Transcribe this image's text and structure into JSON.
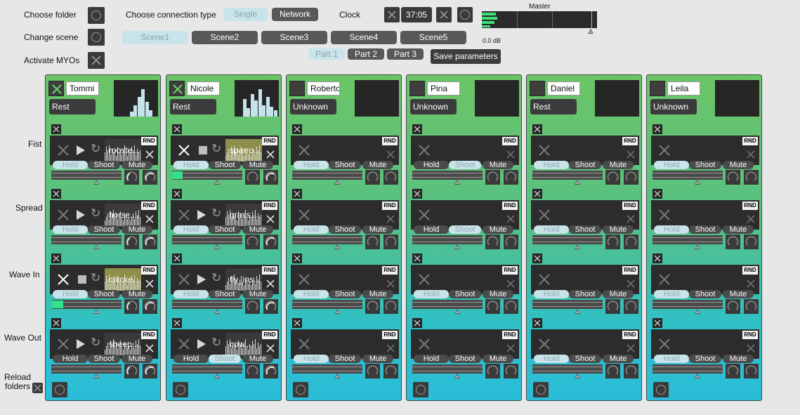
{
  "controls": {
    "choose_folder": "Choose folder",
    "change_scene": "Change scene",
    "activate_myos": "Activate MYOs",
    "choose_connection_type": "Choose connection type",
    "conn_single": "Single",
    "conn_network": "Network",
    "clock": "Clock",
    "clock_value": "37:05",
    "master": "Master",
    "master_db": "0.0 dB",
    "save_parameters": "Save parameters",
    "reload_folders": "Reload\nfolders"
  },
  "scenes": [
    "Scene1",
    "Scene2",
    "Scene3",
    "Scene4",
    "Scene5"
  ],
  "active_scene": 0,
  "parts": [
    "Part 1",
    "Part 2",
    "Part 3"
  ],
  "active_part": 0,
  "gestures": [
    "Fist",
    "Spread",
    "Wave In",
    "Wave Out"
  ],
  "button_labels": {
    "hold": "Hold",
    "shoot": "Shoot",
    "mute": "Mute",
    "rnd": "RND"
  },
  "players": [
    {
      "name": "Tommi",
      "state": "Rest",
      "enabled": true,
      "histogram": [
        0,
        0,
        0,
        0.15,
        0.35,
        0.6,
        0.85,
        0.45,
        0.2,
        0
      ],
      "slots": [
        {
          "file": "rooste...",
          "playing": false,
          "mode": [
            "off",
            "on",
            "on"
          ],
          "level": 0
        },
        {
          "file": "horse....",
          "playing": false,
          "mode": [
            "off",
            "on",
            "on"
          ],
          "level": 0
        },
        {
          "file": "chicke...",
          "playing": true,
          "mode": [
            "off",
            "on",
            "on"
          ],
          "level": 0.17
        },
        {
          "file": "sheep....",
          "playing": false,
          "mode": [
            "on",
            "on",
            "on"
          ],
          "level": 0
        }
      ]
    },
    {
      "name": "Nicole",
      "state": "Rest",
      "enabled": true,
      "histogram": [
        0,
        0.55,
        0.25,
        0.7,
        0.5,
        0.85,
        0.35,
        0.6,
        0.3,
        0.2
      ],
      "slots": [
        {
          "file": "sparro...",
          "playing": true,
          "mode": [
            "off",
            "on",
            "on"
          ],
          "level": 0.15
        },
        {
          "file": "grass....",
          "playing": false,
          "mode": [
            "off",
            "on",
            "on"
          ],
          "level": 0
        },
        {
          "file": "fly_ins...",
          "playing": false,
          "mode": [
            "off",
            "on",
            "on"
          ],
          "level": 0
        },
        {
          "file": "cow....",
          "playing": false,
          "mode": [
            "on",
            "off",
            "on"
          ],
          "level": 0
        }
      ]
    },
    {
      "name": "Roberto",
      "state": "Unknown",
      "enabled": false,
      "histogram": [],
      "slots": [
        {
          "file": "",
          "playing": false,
          "mode": [
            "off",
            "on",
            "on"
          ],
          "level": 0
        },
        {
          "file": "",
          "playing": false,
          "mode": [
            "off",
            "on",
            "on"
          ],
          "level": 0
        },
        {
          "file": "",
          "playing": false,
          "mode": [
            "off",
            "on",
            "on"
          ],
          "level": 0
        },
        {
          "file": "",
          "playing": false,
          "mode": [
            "off",
            "on",
            "on"
          ],
          "level": 0
        }
      ]
    },
    {
      "name": "Pina",
      "state": "Unknown",
      "enabled": false,
      "histogram": [],
      "slots": [
        {
          "file": "",
          "playing": false,
          "mode": [
            "on",
            "off",
            "on"
          ],
          "level": 0
        },
        {
          "file": "",
          "playing": false,
          "mode": [
            "on",
            "off",
            "on"
          ],
          "level": 0
        },
        {
          "file": "",
          "playing": false,
          "mode": [
            "off",
            "on",
            "on"
          ],
          "level": 0
        },
        {
          "file": "",
          "playing": false,
          "mode": [
            "on",
            "on",
            "on"
          ],
          "level": 0
        }
      ]
    },
    {
      "name": "Daniel",
      "state": "Rest",
      "enabled": false,
      "histogram": [],
      "slots": [
        {
          "file": "",
          "playing": false,
          "mode": [
            "off",
            "on",
            "on"
          ],
          "level": 0
        },
        {
          "file": "",
          "playing": false,
          "mode": [
            "off",
            "on",
            "on"
          ],
          "level": 0
        },
        {
          "file": "",
          "playing": false,
          "mode": [
            "off",
            "on",
            "on"
          ],
          "level": 0
        },
        {
          "file": "",
          "playing": false,
          "mode": [
            "off",
            "on",
            "on"
          ],
          "level": 0
        }
      ]
    },
    {
      "name": "Leila",
      "state": "Unknown",
      "enabled": false,
      "histogram": [],
      "slots": [
        {
          "file": "",
          "playing": false,
          "mode": [
            "off",
            "on",
            "on"
          ],
          "level": 0
        },
        {
          "file": "",
          "playing": false,
          "mode": [
            "off",
            "on",
            "on"
          ],
          "level": 0
        },
        {
          "file": "",
          "playing": false,
          "mode": [
            "off",
            "on",
            "on"
          ],
          "level": 0
        },
        {
          "file": "",
          "playing": false,
          "mode": [
            "off",
            "on",
            "on"
          ],
          "level": 0
        }
      ]
    }
  ]
}
